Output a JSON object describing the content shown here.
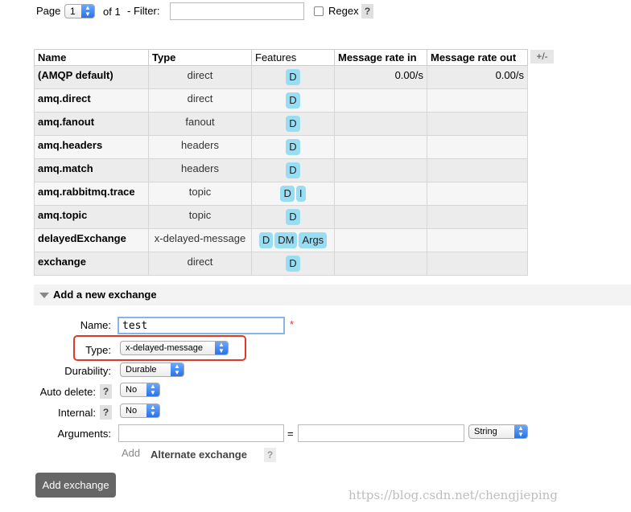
{
  "paging": {
    "page_label": "Page",
    "page_value": "1",
    "of_label": "of 1",
    "filter_label": "- Filter:",
    "filter_value": "",
    "regex_label": "Regex",
    "help": "?"
  },
  "table": {
    "headers": [
      "Name",
      "Type",
      "Features",
      "Message rate in",
      "Message rate out"
    ],
    "toggle_columns": "+/-",
    "rows": [
      {
        "name": "(AMQP default)",
        "type": "direct",
        "features": [
          "D"
        ],
        "rate_in": "0.00/s",
        "rate_out": "0.00/s"
      },
      {
        "name": "amq.direct",
        "type": "direct",
        "features": [
          "D"
        ],
        "rate_in": "",
        "rate_out": ""
      },
      {
        "name": "amq.fanout",
        "type": "fanout",
        "features": [
          "D"
        ],
        "rate_in": "",
        "rate_out": ""
      },
      {
        "name": "amq.headers",
        "type": "headers",
        "features": [
          "D"
        ],
        "rate_in": "",
        "rate_out": ""
      },
      {
        "name": "amq.match",
        "type": "headers",
        "features": [
          "D"
        ],
        "rate_in": "",
        "rate_out": ""
      },
      {
        "name": "amq.rabbitmq.trace",
        "type": "topic",
        "features": [
          "D",
          "I"
        ],
        "rate_in": "",
        "rate_out": ""
      },
      {
        "name": "amq.topic",
        "type": "topic",
        "features": [
          "D"
        ],
        "rate_in": "",
        "rate_out": ""
      },
      {
        "name": "delayedExchange",
        "type": "x-delayed-message",
        "features": [
          "D",
          "DM",
          "Args"
        ],
        "rate_in": "",
        "rate_out": ""
      },
      {
        "name": "exchange",
        "type": "direct",
        "features": [
          "D"
        ],
        "rate_in": "",
        "rate_out": ""
      }
    ]
  },
  "form": {
    "section_title": "Add a new exchange",
    "name_label": "Name:",
    "name_value": "test",
    "required_mark": "*",
    "type_label": "Type:",
    "type_value": "x-delayed-message",
    "durability_label": "Durability:",
    "durability_value": "Durable",
    "auto_delete_label": "Auto delete:",
    "auto_delete_value": "No",
    "internal_label": "Internal:",
    "internal_value": "No",
    "arguments_label": "Arguments:",
    "equals": "=",
    "arg_type_value": "String",
    "add_label": "Add",
    "alternate_exchange_label": "Alternate exchange",
    "help": "?",
    "submit_label": "Add exchange"
  },
  "watermark": "https://blog.csdn.net/chengjieping",
  "colors": {
    "feature_tag": "#99ddf2",
    "highlight_box": "#e0392a",
    "select_arrow": "#2a72e6"
  }
}
